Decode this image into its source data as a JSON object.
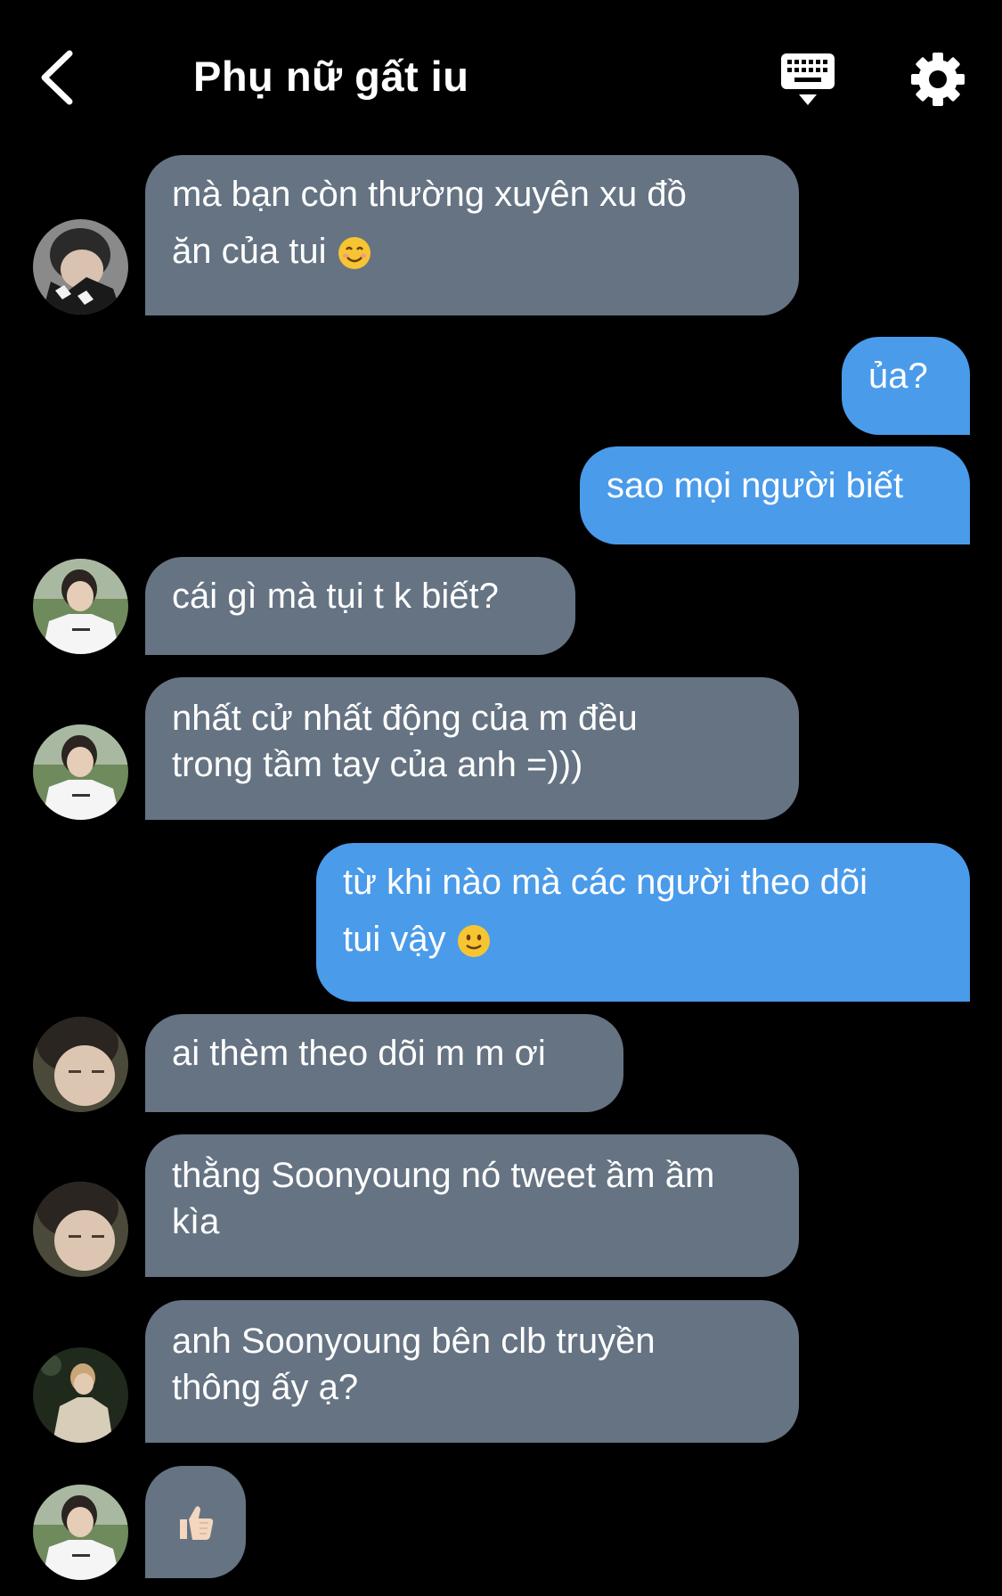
{
  "header": {
    "title": "Phụ nữ gất iu",
    "back_icon": "chevron-left-icon",
    "keyboard_icon": "keyboard-hide-icon",
    "settings_icon": "gear-icon"
  },
  "colors": {
    "background": "#000000",
    "incoming_bubble": "#657383",
    "outgoing_bubble": "#4a9bea",
    "text": "#ffffff"
  },
  "messages": [
    {
      "side": "incoming",
      "avatar": "avatar-boy-dark-hoodie",
      "lines": [
        "mà bạn còn thường xuyên xu đồ",
        "ăn của tui"
      ],
      "emoji": "smiling-face-icon"
    },
    {
      "side": "outgoing",
      "lines": [
        "ủa?"
      ]
    },
    {
      "side": "outgoing",
      "lines": [
        "sao mọi người biết"
      ]
    },
    {
      "side": "incoming",
      "avatar": "avatar-boy-white-tee",
      "lines": [
        "cái gì mà tụi t k biết?"
      ]
    },
    {
      "side": "incoming",
      "avatar": "avatar-boy-white-tee",
      "lines": [
        "nhất cử nhất động của m đều",
        "trong tầm tay của anh =)))"
      ]
    },
    {
      "side": "outgoing",
      "lines": [
        "từ khi nào mà các người theo dõi",
        "tui vậy"
      ],
      "emoji": "slight-smile-icon"
    },
    {
      "side": "incoming",
      "avatar": "avatar-boy-closeup",
      "lines": [
        "ai thèm theo dõi m m ơi"
      ]
    },
    {
      "side": "incoming",
      "avatar": "avatar-boy-closeup",
      "lines": [
        "thằng Soonyoung nó tweet ầm ầm",
        "kìa"
      ]
    },
    {
      "side": "incoming",
      "avatar": "avatar-boy-beige-jacket",
      "lines": [
        "anh Soonyoung bên clb truyền",
        "thông ấy ạ?"
      ]
    },
    {
      "side": "incoming",
      "avatar": "avatar-boy-white-tee",
      "lines": [],
      "emoji": "thumbs-up-icon"
    }
  ]
}
